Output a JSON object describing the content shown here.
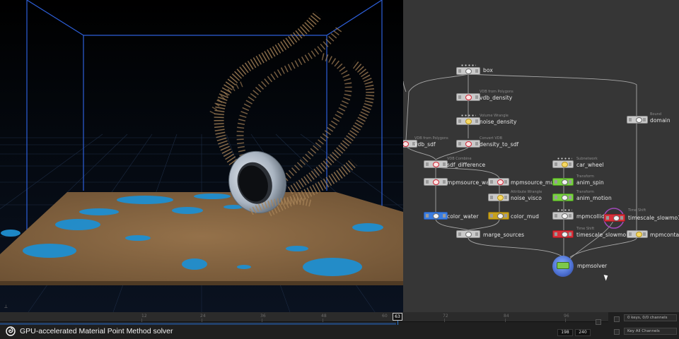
{
  "timeline": {
    "ticks": [
      "12",
      "24",
      "36",
      "48",
      "60",
      "72",
      "84",
      "96"
    ],
    "current_frame": "63",
    "range_start": "198",
    "range_end": "240",
    "keys_label": "0 keys, 0/0 channels",
    "channels_label": "Key All Channels"
  },
  "caption": {
    "text": "GPU-accelerated Material Point Method solver"
  },
  "network": {
    "nodes": {
      "box": {
        "name": "box"
      },
      "vdb_density": {
        "name": "vdb_density",
        "sub": "VDB from Polygons"
      },
      "noise_density": {
        "name": "noise_density",
        "sub": "Volume Wrangle"
      },
      "vdb_sdf": {
        "name": "vdb_sdf",
        "sub": "VDB from Polygons"
      },
      "density_to_sdf": {
        "name": "density_to_sdf",
        "sub": "Convert VDB"
      },
      "sdf_difference": {
        "name": "sdf_difference",
        "sub": "VDB Combine"
      },
      "mpmsource_water": {
        "name": "mpmsource_water"
      },
      "mpmsource_mud": {
        "name": "mpmsource_mud"
      },
      "noise_visco": {
        "name": "noise_visco",
        "sub": "Attribute Wrangle"
      },
      "color_water": {
        "name": "color_water"
      },
      "color_mud": {
        "name": "color_mud"
      },
      "marge_sources": {
        "name": "marge_sources"
      },
      "car_wheel": {
        "name": "car_wheel",
        "sub": "Subnetwork"
      },
      "anim_spin": {
        "name": "anim_spin",
        "sub": "Transform"
      },
      "anim_motion": {
        "name": "anim_motion",
        "sub": "Transform"
      },
      "mpmcollider": {
        "name": "mpmcollider"
      },
      "timescale_slowmo1": {
        "name": "timescale_slowmo1",
        "sub": "Time Shift"
      },
      "timescale_slowmo": {
        "name": "timescale_slowmo",
        "sub": "Time Shift"
      },
      "mpmcontainer": {
        "name": "mpmcontaine"
      },
      "domain": {
        "name": "domain",
        "sub": "Bound"
      },
      "mpmsolver": {
        "name": "mpmsolver"
      }
    }
  },
  "colors": {
    "ground_sand": "#8a6a45",
    "water": "#1f8fd0",
    "box_edges": "#2d5fd9",
    "node_blue": "#3b7de0",
    "node_yellow": "#c7a11e",
    "node_red": "#d8303a",
    "node_green": "#77d13f"
  }
}
